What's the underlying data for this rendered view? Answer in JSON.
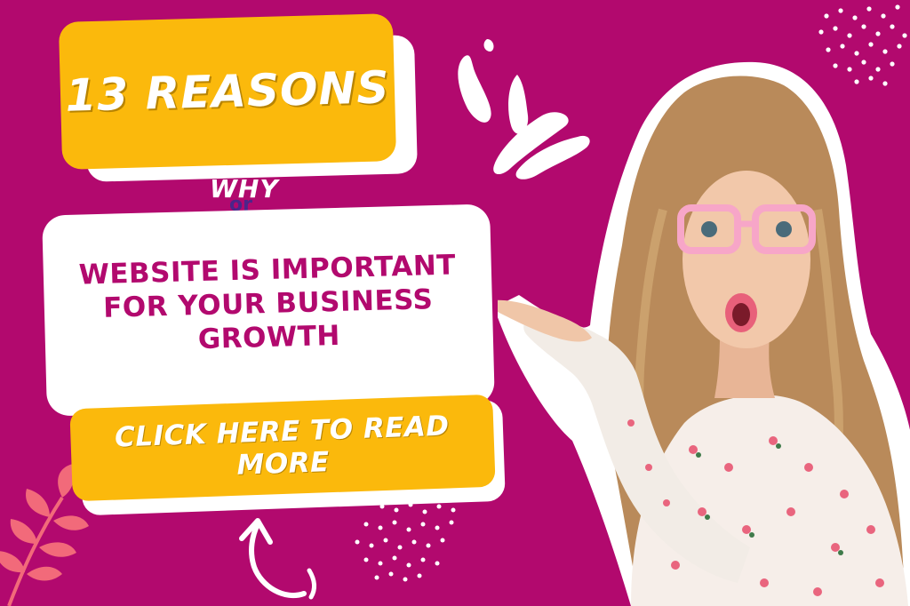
{
  "banner": {
    "title": "13 REASONS",
    "why": "WHY",
    "why_overlay": "or",
    "headline_lines": [
      "WEBSITE IS IMPORTANT",
      "FOR YOUR BUSINESS",
      "GROWTH"
    ],
    "cta_label": "CLICK HERE TO READ MORE"
  },
  "colors": {
    "background": "#b2096e",
    "accent_yellow": "#fbb90c",
    "white": "#ffffff",
    "headline_text": "#b2096e",
    "leaf": "#f26a7a"
  },
  "icons": [
    "curved-arrow-icon",
    "splash-icon",
    "leaf-icon",
    "dots-pattern-icon"
  ]
}
